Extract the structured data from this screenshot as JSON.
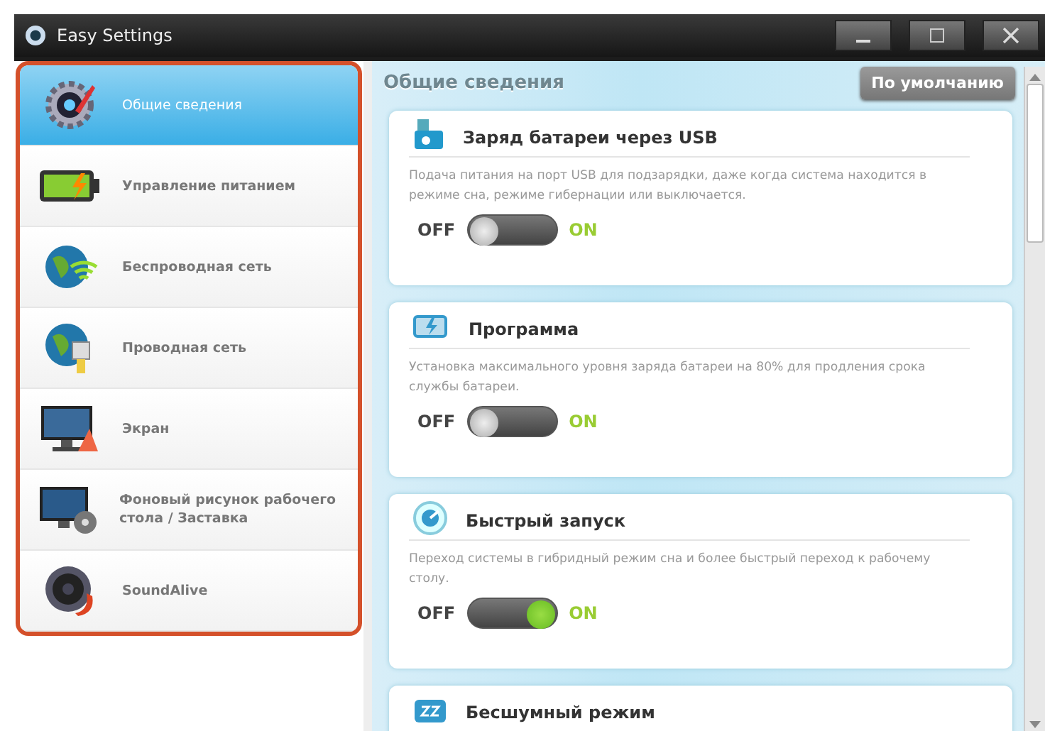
{
  "window": {
    "title": "Easy Settings"
  },
  "sidebar": {
    "items": [
      {
        "label": "Общие сведения",
        "selected": true
      },
      {
        "label": "Управление питанием",
        "selected": false
      },
      {
        "label": "Беспроводная сеть",
        "selected": false
      },
      {
        "label": "Проводная сеть",
        "selected": false
      },
      {
        "label": "Экран",
        "selected": false
      },
      {
        "label": "Фоновый рисунок рабочего стола / Заставка",
        "selected": false
      },
      {
        "label": "SoundAlive",
        "selected": false
      }
    ]
  },
  "content": {
    "title": "Общие сведения",
    "default_button": "По умолчанию",
    "cards": [
      {
        "title": "Заряд батареи через USB",
        "description": "Подача питания на порт USB для подзарядки, даже когда система находится в режиме сна, режиме гибернации или выключается.",
        "off_label": "OFF",
        "on_label": "ON",
        "on": false
      },
      {
        "title": "Программа",
        "description": "Установка максимального уровня заряда батареи на 80% для продления срока службы батареи.",
        "off_label": "OFF",
        "on_label": "ON",
        "on": false
      },
      {
        "title": "Быстрый запуск",
        "description": "Переход системы в гибридный режим сна и более быстрый переход к рабочему столу.",
        "off_label": "OFF",
        "on_label": "ON",
        "on": true
      },
      {
        "title": "Бесшумный режим"
      }
    ]
  }
}
